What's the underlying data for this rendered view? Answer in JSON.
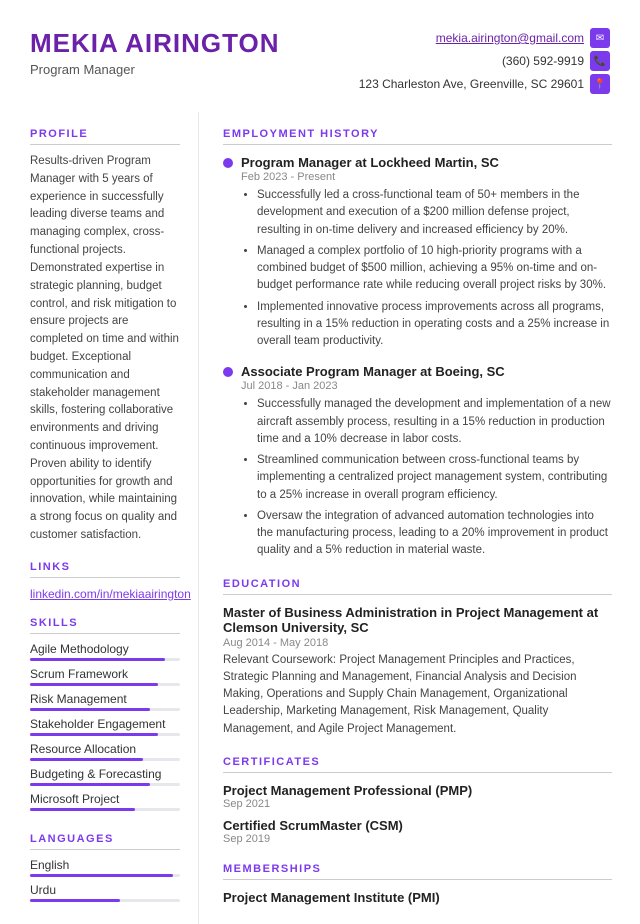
{
  "header": {
    "name": "MEKIA AIRINGTON",
    "title": "Program Manager",
    "email": "mekia.airington@gmail.com",
    "phone": "(360) 592-9919",
    "address": "123 Charleston Ave, Greenville, SC 29601",
    "email_icon": "✉",
    "phone_icon": "📞",
    "location_icon": "📍"
  },
  "left": {
    "profile_label": "PROFILE",
    "profile_text": "Results-driven Program Manager with 5 years of experience in successfully leading diverse teams and managing complex, cross-functional projects. Demonstrated expertise in strategic planning, budget control, and risk mitigation to ensure projects are completed on time and within budget. Exceptional communication and stakeholder management skills, fostering collaborative environments and driving continuous improvement. Proven ability to identify opportunities for growth and innovation, while maintaining a strong focus on quality and customer satisfaction.",
    "links_label": "LINKS",
    "linkedin": "linkedin.com/in/mekiaairington",
    "skills_label": "SKILLS",
    "skills": [
      {
        "name": "Agile Methodology",
        "pct": 90
      },
      {
        "name": "Scrum Framework",
        "pct": 85
      },
      {
        "name": "Risk Management",
        "pct": 80
      },
      {
        "name": "Stakeholder Engagement",
        "pct": 85
      },
      {
        "name": "Resource Allocation",
        "pct": 75
      },
      {
        "name": "Budgeting & Forecasting",
        "pct": 80
      },
      {
        "name": "Microsoft Project",
        "pct": 70
      }
    ],
    "languages_label": "LANGUAGES",
    "languages": [
      {
        "name": "English",
        "pct": 95
      },
      {
        "name": "Urdu",
        "pct": 60
      }
    ]
  },
  "right": {
    "employment_label": "EMPLOYMENT HISTORY",
    "jobs": [
      {
        "title": "Program Manager at Lockheed Martin, SC",
        "dates": "Feb 2023 - Present",
        "bullets": [
          "Successfully led a cross-functional team of 50+ members in the development and execution of a $200 million defense project, resulting in on-time delivery and increased efficiency by 20%.",
          "Managed a complex portfolio of 10 high-priority programs with a combined budget of $500 million, achieving a 95% on-time and on-budget performance rate while reducing overall project risks by 30%.",
          "Implemented innovative process improvements across all programs, resulting in a 15% reduction in operating costs and a 25% increase in overall team productivity."
        ]
      },
      {
        "title": "Associate Program Manager at Boeing, SC",
        "dates": "Jul 2018 - Jan 2023",
        "bullets": [
          "Successfully managed the development and implementation of a new aircraft assembly process, resulting in a 15% reduction in production time and a 10% decrease in labor costs.",
          "Streamlined communication between cross-functional teams by implementing a centralized project management system, contributing to a 25% increase in overall program efficiency.",
          "Oversaw the integration of advanced automation technologies into the manufacturing process, leading to a 20% improvement in product quality and a 5% reduction in material waste."
        ]
      }
    ],
    "education_label": "EDUCATION",
    "education": {
      "degree": "Master of Business Administration in Project Management at Clemson University, SC",
      "dates": "Aug 2014 - May 2018",
      "desc": "Relevant Coursework: Project Management Principles and Practices, Strategic Planning and Management, Financial Analysis and Decision Making, Operations and Supply Chain Management, Organizational Leadership, Marketing Management, Risk Management, Quality Management, and Agile Project Management."
    },
    "certificates_label": "CERTIFICATES",
    "certificates": [
      {
        "title": "Project Management Professional (PMP)",
        "date": "Sep 2021"
      },
      {
        "title": "Certified ScrumMaster (CSM)",
        "date": "Sep 2019"
      }
    ],
    "memberships_label": "MEMBERSHIPS",
    "memberships": [
      {
        "title": "Project Management Institute (PMI)"
      }
    ]
  }
}
